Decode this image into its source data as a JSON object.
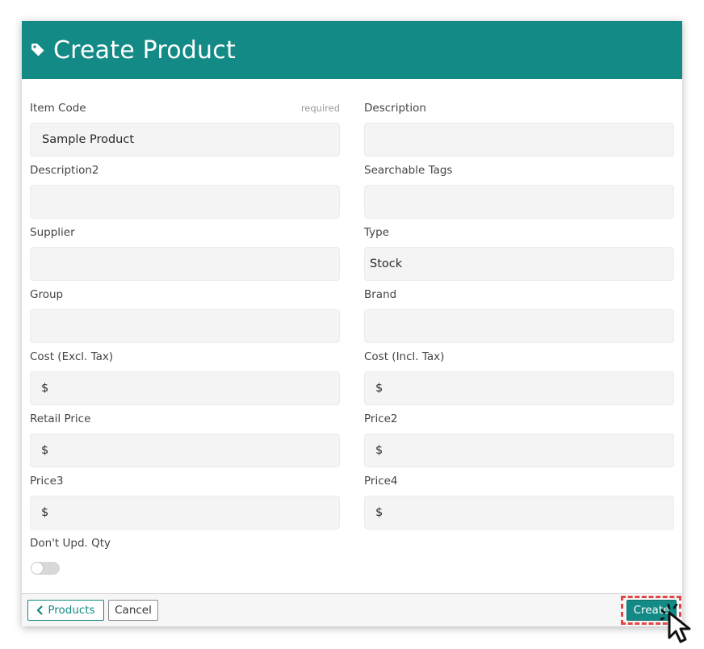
{
  "header": {
    "icon": "tag-icon",
    "title": "Create Product"
  },
  "fields": {
    "item_code": {
      "label": "Item Code",
      "required": "required",
      "value": "Sample Product"
    },
    "description": {
      "label": "Description",
      "value": ""
    },
    "description2": {
      "label": "Description2",
      "value": ""
    },
    "searchable_tags": {
      "label": "Searchable Tags",
      "value": ""
    },
    "supplier": {
      "label": "Supplier",
      "value": ""
    },
    "type": {
      "label": "Type",
      "value": "Stock"
    },
    "group": {
      "label": "Group",
      "value": ""
    },
    "brand": {
      "label": "Brand",
      "value": ""
    },
    "cost_excl": {
      "label": "Cost (Excl. Tax)",
      "value": "$"
    },
    "cost_incl": {
      "label": "Cost (Incl. Tax)",
      "value": "$"
    },
    "retail_price": {
      "label": "Retail Price",
      "value": "$"
    },
    "price2": {
      "label": "Price2",
      "value": "$"
    },
    "price3": {
      "label": "Price3",
      "value": "$"
    },
    "price4": {
      "label": "Price4",
      "value": "$"
    },
    "dont_upd_qty": {
      "label": "Don't Upd. Qty",
      "checked": false
    }
  },
  "footer": {
    "products_label": "Products",
    "cancel_label": "Cancel",
    "create_label": "Create"
  },
  "colors": {
    "accent": "#138a85",
    "highlight": "#e04848"
  }
}
